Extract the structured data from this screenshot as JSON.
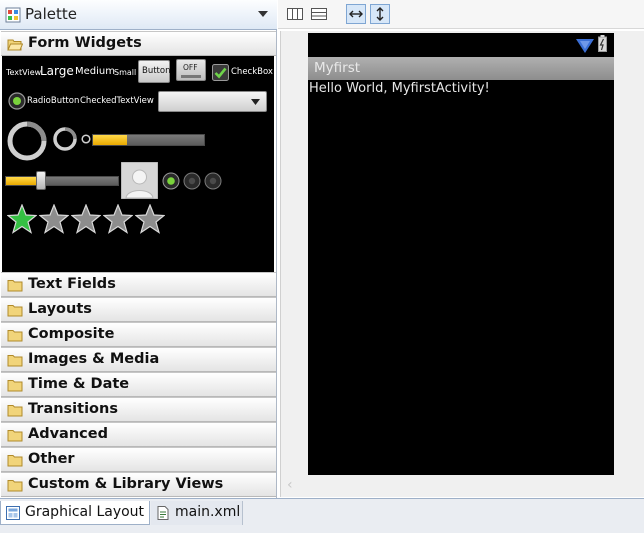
{
  "palette": {
    "title": "Palette",
    "open_category": "Form Widgets",
    "categories": [
      "Text Fields",
      "Layouts",
      "Composite",
      "Images & Media",
      "Time & Date",
      "Transitions",
      "Advanced",
      "Other",
      "Custom & Library Views"
    ],
    "widgets": {
      "textview_small": "TextView",
      "large": "Large",
      "medium": "Medium",
      "small": "Small",
      "button": "Button",
      "toggle_off": "OFF",
      "checkbox": "CheckBox",
      "radio_button": "RadioButton",
      "checked_text_view": "CheckedTextView",
      "rating_stars": 5,
      "rating_filled": 1
    }
  },
  "preview": {
    "app_title": "Myfirst",
    "hello_text": "Hello World, MyfirstActivity!"
  },
  "tabs": [
    {
      "label": "Graphical Layout",
      "active": true
    },
    {
      "label": "main.xml",
      "active": false
    }
  ],
  "colors": {
    "accent_yellow": "#f7c300",
    "star_green": "#35c043",
    "header_blue": "#dfe9f5"
  }
}
